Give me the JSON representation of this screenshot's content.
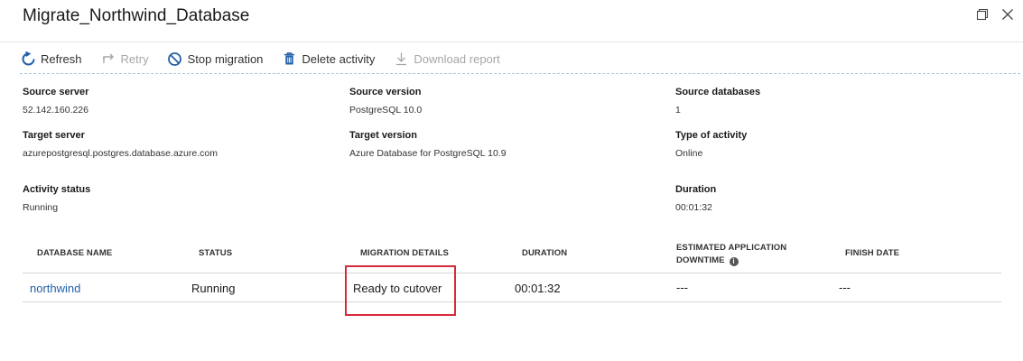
{
  "window": {
    "title": "Migrate_Northwind_Database"
  },
  "toolbar": {
    "refresh": "Refresh",
    "retry": "Retry",
    "stop_migration": "Stop migration",
    "delete_activity": "Delete activity",
    "download_report": "Download report"
  },
  "details": {
    "source_server_label": "Source server",
    "source_server_value": "52.142.160.226",
    "source_version_label": "Source version",
    "source_version_value": "PostgreSQL 10.0",
    "source_databases_label": "Source databases",
    "source_databases_value": "1",
    "target_server_label": "Target server",
    "target_server_value": "azurepostgresql.postgres.database.azure.com",
    "target_version_label": "Target version",
    "target_version_value": "Azure Database for PostgreSQL 10.9",
    "type_of_activity_label": "Type of activity",
    "type_of_activity_value": "Online",
    "activity_status_label": "Activity status",
    "activity_status_value": "Running",
    "duration_label": "Duration",
    "duration_value": "00:01:32"
  },
  "table": {
    "headers": {
      "database_name": "DATABASE NAME",
      "status": "STATUS",
      "migration_details": "MIGRATION DETAILS",
      "duration": "DURATION",
      "estimated_downtime_line1": "ESTIMATED APPLICATION",
      "estimated_downtime_line2": "DOWNTIME",
      "finish_date": "FINISH DATE"
    },
    "rows": [
      {
        "database_name": "northwind",
        "status": "Running",
        "migration_details": "Ready to cutover",
        "duration": "00:01:32",
        "estimated_downtime": "---",
        "finish_date": "---"
      }
    ]
  },
  "colors": {
    "link": "#2360a8",
    "highlight": "#d6293b",
    "accent_icon": "#2360a8"
  }
}
